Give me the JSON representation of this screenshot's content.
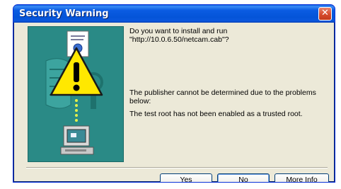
{
  "window": {
    "title": "Security Warning"
  },
  "message": {
    "question_line1": "Do you want to install and run",
    "question_line2": "\"http://10.0.6.50/netcam.cab\"?",
    "publisher_line1": "The publisher cannot be determined due to the problems",
    "publisher_line2": "below:",
    "detail": "The test root has not been enabled as a trusted root."
  },
  "buttons": {
    "yes": "Yes",
    "no": "No",
    "more_info": "More Info"
  },
  "icons": {
    "close": "close-icon",
    "warning": "warning-icon",
    "certificate": "certificate-icon",
    "computer": "computer-icon"
  },
  "colors": {
    "titlebar": "#0454d8",
    "panel": "#2a8a86",
    "warning_yellow": "#ffe800",
    "dialog_bg": "#ece9d8"
  }
}
